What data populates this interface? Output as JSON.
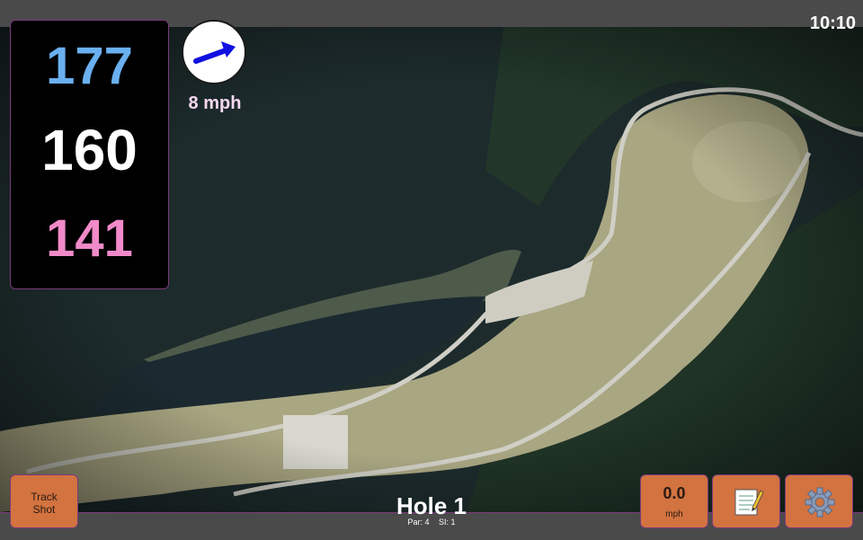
{
  "status": {
    "time": "10:10"
  },
  "yardage": {
    "back": "177",
    "center": "160",
    "front": "141"
  },
  "wind": {
    "speed": "8 mph",
    "direction_icon": "wind-arrow-icon"
  },
  "buttons": {
    "track_shot_line1": "Track",
    "track_shot_line2": "Shot",
    "speed_value": "0.0",
    "speed_unit": "mph",
    "notes_icon": "notepad-icon",
    "settings_icon": "gear-icon"
  },
  "hole": {
    "title": "Hole 1",
    "par": "Par: 4",
    "si": "SI: 1"
  },
  "colors": {
    "accent": "#d27340",
    "back_yardage": "#6ab0f0",
    "center_yardage": "#ffffff",
    "front_yardage": "#f08ac8",
    "border": "#7a3a7a"
  }
}
